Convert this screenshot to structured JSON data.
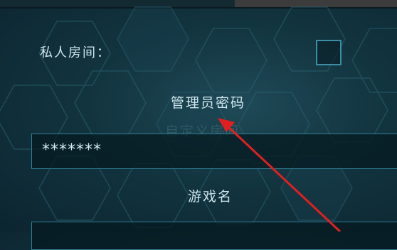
{
  "form": {
    "private_room_label": "私人房间：",
    "admin_password_label": "管理员密码",
    "ghost_text": "自定义房间",
    "password_value": "*******",
    "game_name_label": "游戏名"
  },
  "colors": {
    "accent": "#2f7f96",
    "annotation_arrow": "#e02020"
  }
}
